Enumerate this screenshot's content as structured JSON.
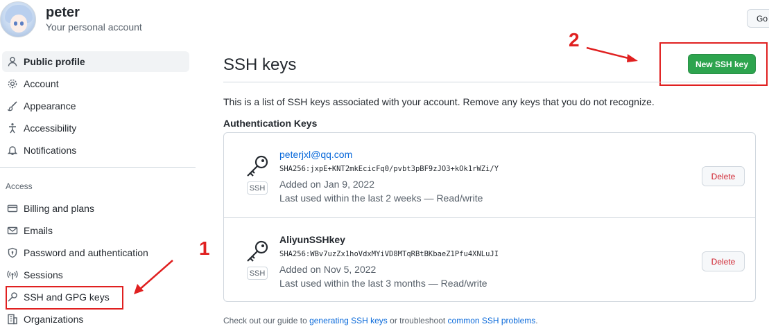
{
  "user": {
    "name": "peter",
    "subtitle": "Your personal account",
    "goto_label": "Go"
  },
  "sidebar": {
    "items_top": [
      {
        "label": "Public profile",
        "icon": "person-icon",
        "selected": true
      },
      {
        "label": "Account",
        "icon": "gear-icon"
      },
      {
        "label": "Appearance",
        "icon": "paintbrush-icon"
      },
      {
        "label": "Accessibility",
        "icon": "accessibility-icon"
      },
      {
        "label": "Notifications",
        "icon": "bell-icon"
      }
    ],
    "section_label": "Access",
    "items_access": [
      {
        "label": "Billing and plans",
        "icon": "credit-card-icon"
      },
      {
        "label": "Emails",
        "icon": "mail-icon"
      },
      {
        "label": "Password and authentication",
        "icon": "shield-lock-icon"
      },
      {
        "label": "Sessions",
        "icon": "broadcast-icon"
      },
      {
        "label": "SSH and GPG keys",
        "icon": "key-icon"
      },
      {
        "label": "Organizations",
        "icon": "organization-icon"
      }
    ]
  },
  "annotations": {
    "marker_1": "1",
    "marker_2": "2",
    "color": "#e02020"
  },
  "main": {
    "title": "SSH keys",
    "new_key_button": "New SSH key",
    "description": "This is a list of SSH keys associated with your account. Remove any keys that you do not recognize.",
    "auth_title": "Authentication Keys",
    "keys": [
      {
        "name": "peterjxl@qq.com",
        "badge": "SSH",
        "fingerprint": "SHA256:jxpE+KNT2mkEcicFq0/pvbt3pBF9zJO3+kOk1rWZi/Y",
        "added": "Added on Jan 9, 2022",
        "last_used": "Last used within the last 2 weeks — Read/write",
        "delete_label": "Delete"
      },
      {
        "name": "AliyunSSHkey",
        "badge": "SSH",
        "fingerprint": "SHA256:WBv7uzZx1hoVdxMYiVD8MTqRBtBKbaeZ1Pfu4XNLuJI",
        "added": "Added on Nov 5, 2022",
        "last_used": "Last used within the last 3 months — Read/write",
        "delete_label": "Delete"
      }
    ],
    "footer": {
      "pre": "Check out our guide to ",
      "link1": "generating SSH keys",
      "mid": " or troubleshoot ",
      "link2": "common SSH problems",
      "post": "."
    }
  },
  "colors": {
    "primary_button": "#2da44e",
    "link": "#0969da",
    "danger": "#cf222e"
  }
}
